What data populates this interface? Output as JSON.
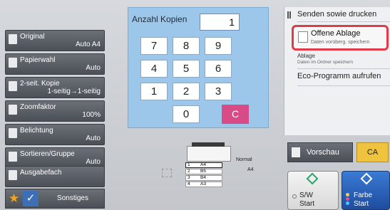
{
  "left_buttons": [
    {
      "title": "Original",
      "value": "Auto  A4"
    },
    {
      "title": "Papierwahl",
      "value": "Auto"
    },
    {
      "title": "2-seit. Kopie",
      "value": "1-seitig→1-seitig"
    },
    {
      "title": "Zoomfaktor",
      "value": "100%"
    },
    {
      "title": "Belichtung",
      "value": "Auto"
    },
    {
      "title": "Sortieren/Gruppe",
      "value": "Auto"
    },
    {
      "title": "Ausgabefach",
      "value": ""
    }
  ],
  "bottom_bar": {
    "label": "Sonstiges"
  },
  "keypad": {
    "label": "Anzahl Kopien",
    "value": "1",
    "keys": [
      "7",
      "8",
      "9",
      "4",
      "5",
      "6",
      "1",
      "2",
      "3",
      "0"
    ],
    "clear": "C"
  },
  "menu": {
    "header": "Senden sowie drucken",
    "option_title": "Offene Ablage",
    "option_sub": "Daten vorüberg. speichern",
    "ablage": "Ablage",
    "ablage_sub": "Daten im Ordner speichern",
    "eco": "Eco-Programm aufrufen"
  },
  "preview": {
    "normal": "Normal",
    "size": "A4",
    "trays": [
      {
        "n": "1",
        "v": "A4"
      },
      {
        "n": "2",
        "v": "B5"
      },
      {
        "n": "3",
        "v": "B4"
      },
      {
        "n": "4",
        "v": "A3"
      }
    ]
  },
  "actions": {
    "preview_label": "Vorschau",
    "ca_label": "CA",
    "bw_label": "S/W",
    "bw_sub": "Start",
    "color_label": "Farbe",
    "color_sub": "Start"
  },
  "colors": {
    "accent": "#e03a4b",
    "keypad_bg": "#9dc7ea",
    "clear_key": "#d84b86",
    "color_start": "#2f6cc6"
  }
}
